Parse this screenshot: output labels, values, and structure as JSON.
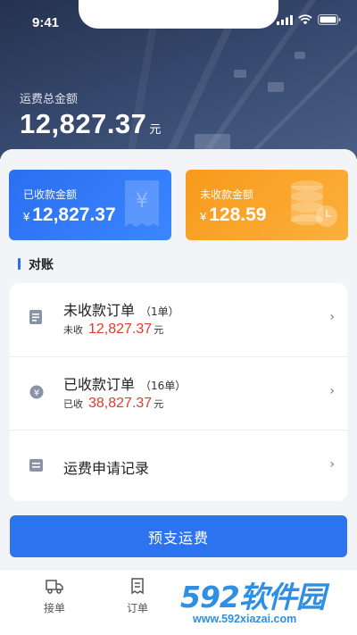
{
  "status_bar": {
    "time": "9:41"
  },
  "header": {
    "label": "运费总金额",
    "amount": "12,827.37",
    "unit": "元"
  },
  "cards": {
    "received": {
      "label": "已收款金额",
      "currency": "¥",
      "value": "12,827.37",
      "color": "#2a6ff2"
    },
    "pending": {
      "label": "未收款金额",
      "currency": "¥",
      "value": "128.59",
      "color": "#f89a1c"
    }
  },
  "section": {
    "title": "对账"
  },
  "list": [
    {
      "title": "未收款订单",
      "count": "（1单）",
      "sub_label": "未收",
      "amount": "12,827.37",
      "unit": "元",
      "icon": "order-doc-icon"
    },
    {
      "title": "已收款订单",
      "count": "（16单）",
      "sub_label": "已收",
      "amount": "38,827.37",
      "unit": "元",
      "icon": "yuan-coin-icon"
    },
    {
      "title": "运费申请记录",
      "icon": "record-doc-icon"
    }
  ],
  "primary_button": {
    "label": "预支运费"
  },
  "tabbar": [
    {
      "label": "接单",
      "icon": "truck-icon"
    },
    {
      "label": "订单",
      "icon": "order-list-icon"
    }
  ],
  "watermark": {
    "brand": "592软件园",
    "url": "www.592xiazai.com"
  }
}
